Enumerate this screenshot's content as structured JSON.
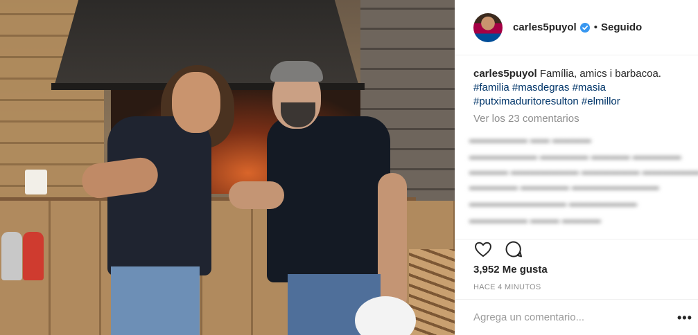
{
  "post": {
    "photo_alt": "",
    "author": {
      "username": "carles5puyol",
      "verified": true,
      "follow_separator": "•",
      "follow_status": "Seguido"
    },
    "caption": {
      "username": "carles5puyol",
      "text": " Família, amics i barbacoa.",
      "hashtags": [
        "#familia",
        "#masdegras",
        "#masia",
        "#putximaduritoresulton",
        "#elmillor"
      ],
      "hashtags_line1": "#familia #masdegras #masia",
      "hashtags_line2": "#putximaduritoresulton #elmillor"
    },
    "view_all_comments": "Ver los 23 comentarios",
    "likes": "3,952 Me gusta",
    "timestamp": "HACE 4 MINUTOS",
    "comment_placeholder": "Agrega un comentario...",
    "more_options": "•••",
    "colors": {
      "text": "#262626",
      "hashtag": "#003569",
      "muted": "#8e8e8e",
      "verified": "#3897f0",
      "border": "#efefef"
    },
    "icons": [
      "heart-icon",
      "comment-icon",
      "verified-badge-icon",
      "more-options-icon"
    ]
  }
}
